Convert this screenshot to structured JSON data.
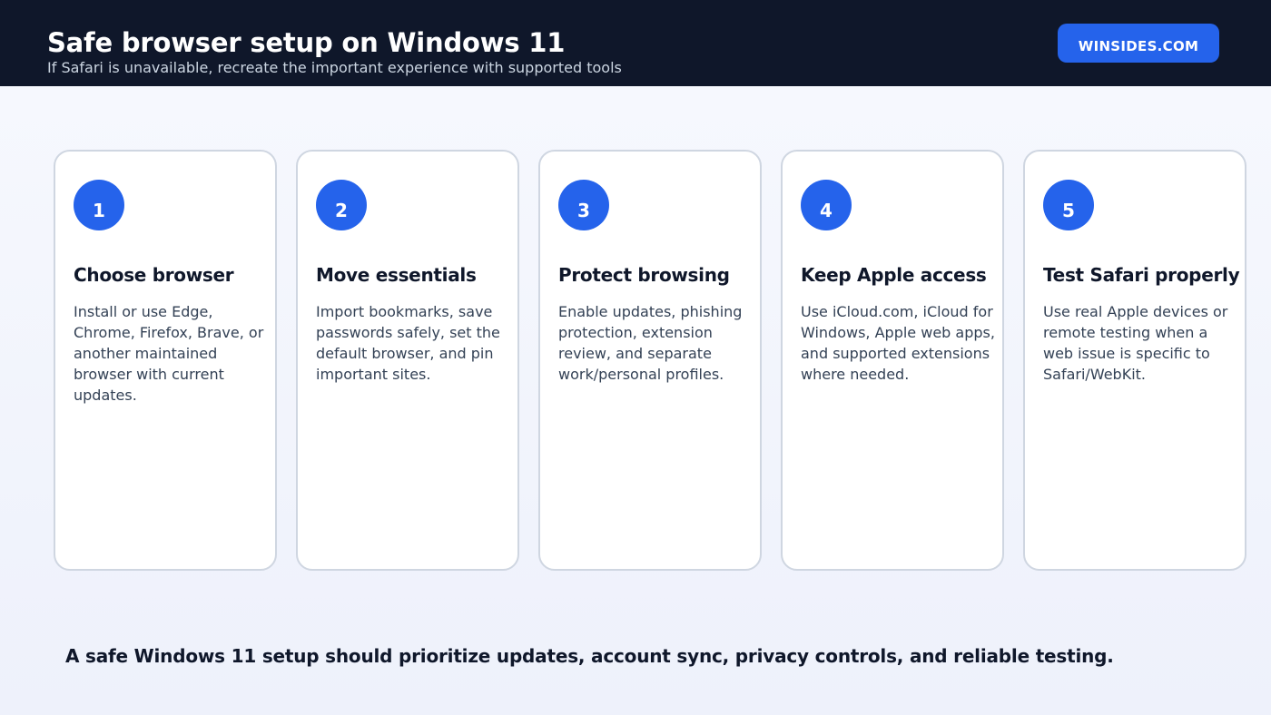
{
  "header": {
    "title": "Safe browser setup on Windows 11",
    "subtitle": "If Safari is unavailable, recreate the important experience with supported tools",
    "brand": "WINSIDES.COM"
  },
  "steps": [
    {
      "number": "1",
      "title": "Choose browser",
      "text": "Install or use Edge, Chrome, Firefox, Brave, or another maintained browser with current updates."
    },
    {
      "number": "2",
      "title": "Move essentials",
      "text": "Import bookmarks, save passwords safely, set the default browser, and pin important sites."
    },
    {
      "number": "3",
      "title": "Protect browsing",
      "text": "Enable updates, phishing protection, extension review, and separate work/personal profiles."
    },
    {
      "number": "4",
      "title": "Keep Apple access",
      "text": "Use iCloud.com, iCloud for Windows, Apple web apps, and supported extensions where needed."
    },
    {
      "number": "5",
      "title": "Test Safari properly",
      "text": "Use real Apple devices or remote testing when a web issue is specific to Safari/WebKit."
    }
  ],
  "footer": {
    "note": "A safe Windows 11 setup should prioritize updates, account sync, privacy controls, and reliable testing."
  },
  "colors": {
    "header_bg": "#0f172a",
    "accent": "#2563eb",
    "card_border": "#cfd6e1"
  }
}
